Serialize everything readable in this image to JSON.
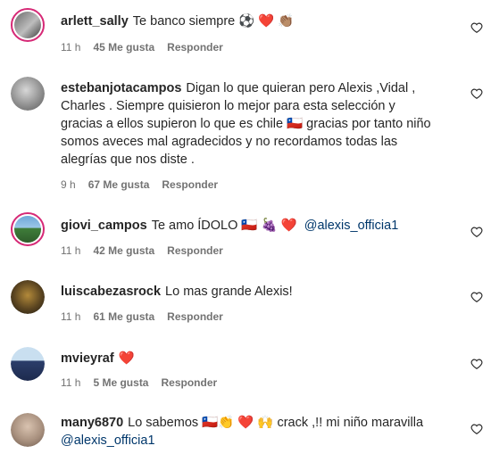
{
  "comments": [
    {
      "user": "arlett_sally",
      "text": "Te banco siempre ⚽ ❤️ 👏🏽",
      "time": "11 h",
      "likes": "45 Me gusta",
      "reply": "Responder"
    },
    {
      "user": "estebanjotacampos",
      "text": "Digan lo que quieran pero Alexis ,Vidal , Charles . Siempre quisieron lo mejor para esta selección y gracias a ellos supieron lo que es chile 🇨🇱 gracias por tanto niño somos aveces mal agradecidos y no recordamos todas las alegrías que nos diste .",
      "time": "9 h",
      "likes": "67 Me gusta",
      "reply": "Responder"
    },
    {
      "user": "giovi_campos",
      "text": "Te amo ÍDOLO 🇨🇱 🍇 ❤️",
      "mention": "@alexis_officia1",
      "time": "11 h",
      "likes": "42 Me gusta",
      "reply": "Responder"
    },
    {
      "user": "luiscabezasrock",
      "text": "Lo mas grande Alexis!",
      "time": "11 h",
      "likes": "61 Me gusta",
      "reply": "Responder"
    },
    {
      "user": "mvieyraf",
      "text": "❤️",
      "time": "11 h",
      "likes": "5 Me gusta",
      "reply": "Responder"
    },
    {
      "user": "many6870",
      "text": "Lo sabemos 🇨🇱👏 ❤️ 🙌 crack ,!! mi niño maravilla",
      "mention": "@alexis_officia1"
    }
  ]
}
